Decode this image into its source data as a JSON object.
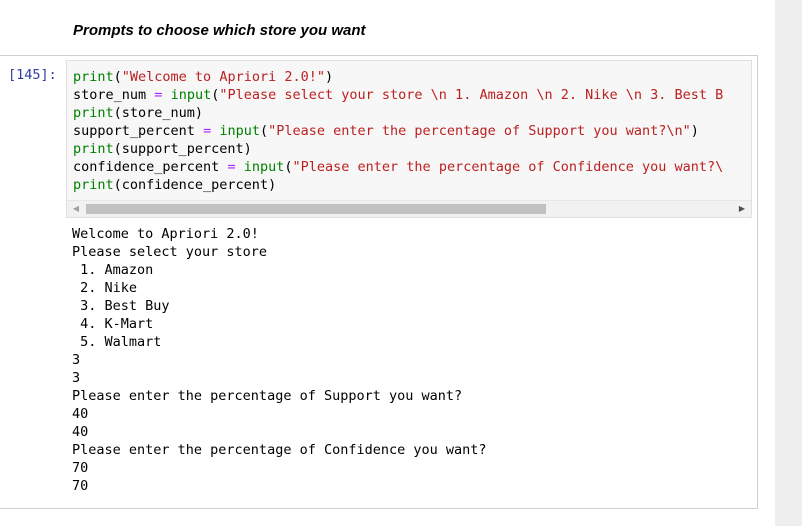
{
  "markdown": {
    "heading": "Prompts to choose which store you want"
  },
  "cell": {
    "prompt": "[145]:",
    "code": {
      "line1": {
        "fn": "print",
        "open": "(",
        "str": "\"Welcome to Apriori 2.0!\"",
        "close": ")"
      },
      "line2": {
        "var": "store_num",
        "op": "=",
        "fn": "input",
        "open": "(",
        "str": "\"Please select your store \\n 1. Amazon \\n 2. Nike \\n 3. Best B"
      },
      "line3": {
        "fn": "print",
        "rest": "(store_num)"
      },
      "line4": {
        "var": "support_percent",
        "op": "=",
        "fn": "input",
        "open": "(",
        "str": "\"Please enter the percentage of Support you want?\\n\"",
        "close": ")"
      },
      "line5": {
        "fn": "print",
        "rest": "(support_percent)"
      },
      "line6": {
        "var": "confidence_percent",
        "op": "=",
        "fn": "input",
        "open": "(",
        "str": "\"Please enter the percentage of Confidence you want?\\"
      },
      "line7": {
        "fn": "print",
        "rest": "(confidence_percent)"
      }
    },
    "output_lines": [
      "Welcome to Apriori 2.0!",
      "Please select your store",
      " 1. Amazon",
      " 2. Nike",
      " 3. Best Buy",
      " 4. K-Mart",
      " 5. Walmart",
      "3",
      "3",
      "Please enter the percentage of Support you want?",
      "40",
      "40",
      "Please enter the percentage of Confidence you want?",
      "70",
      "70"
    ]
  },
  "scrollbar": {
    "left_arrow": "◀",
    "right_arrow": "▶"
  }
}
